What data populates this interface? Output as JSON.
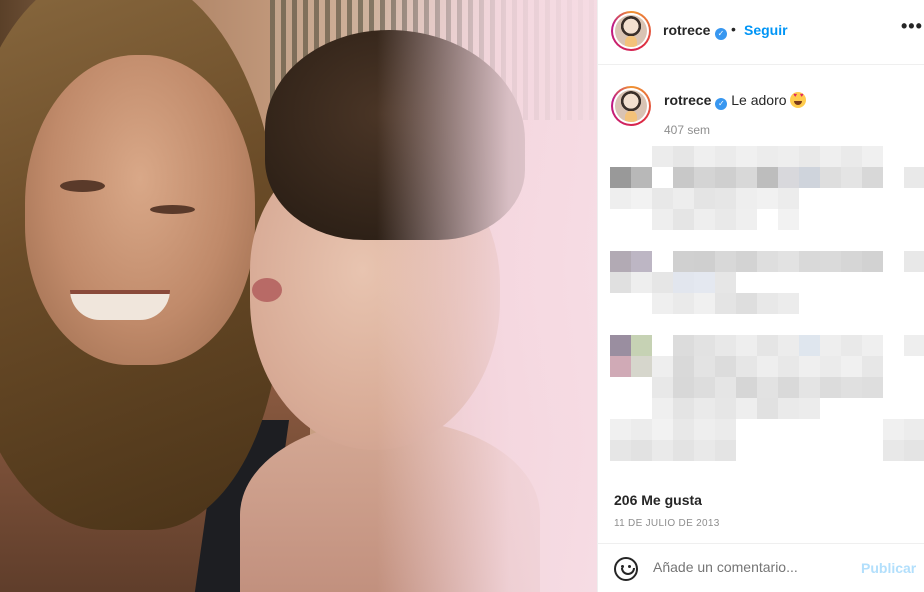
{
  "post": {
    "username": "rotrece",
    "follow_label": "Seguir",
    "separator": "•",
    "more_icon": "•••",
    "caption_text": "Le adoro",
    "caption_emoji": "smiling-face-with-heart-eyes",
    "time_ago": "407 sem",
    "likes": "206 Me gusta",
    "date": "11 DE JULIO DE 2013"
  },
  "comment": {
    "placeholder": "Añade un comentario...",
    "publish_label": "Publicar"
  },
  "verified_icon": "✓",
  "colors": {
    "link_blue": "#0095f6",
    "publish_disabled": "#b2dffc",
    "verified": "#3897f0",
    "muted_text": "#8e8e8e"
  }
}
